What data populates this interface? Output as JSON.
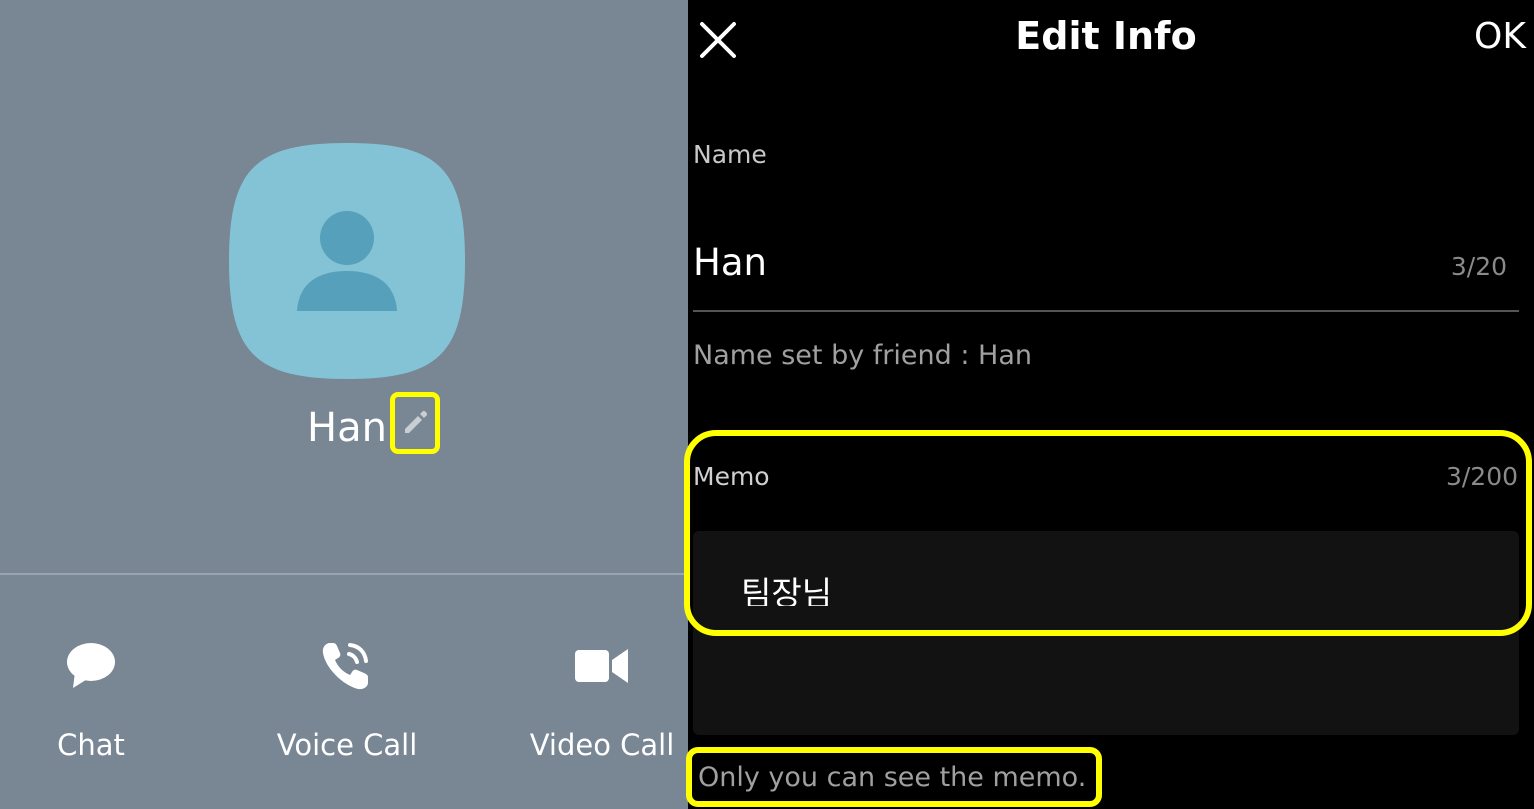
{
  "profile": {
    "name": "Han",
    "actions": [
      {
        "label": "Chat",
        "icon": "chat-bubble-icon"
      },
      {
        "label": "Voice Call",
        "icon": "phone-icon"
      },
      {
        "label": "Video Call",
        "icon": "video-camera-icon"
      }
    ]
  },
  "edit_info": {
    "title": "Edit Info",
    "ok_label": "OK",
    "name_label": "Name",
    "name_value": "Han",
    "name_counter": "3/20",
    "name_set_by": "Name set by friend  : Han",
    "memo_label": "Memo",
    "memo_counter": "3/200",
    "memo_value": "팀장님",
    "memo_note": "Only you can see the memo."
  },
  "colors": {
    "left_background": "#798693",
    "avatar_background": "#84c3d6",
    "avatar_figure": "#56a0bb",
    "right_background": "#000000",
    "highlight": "#ffff00"
  }
}
